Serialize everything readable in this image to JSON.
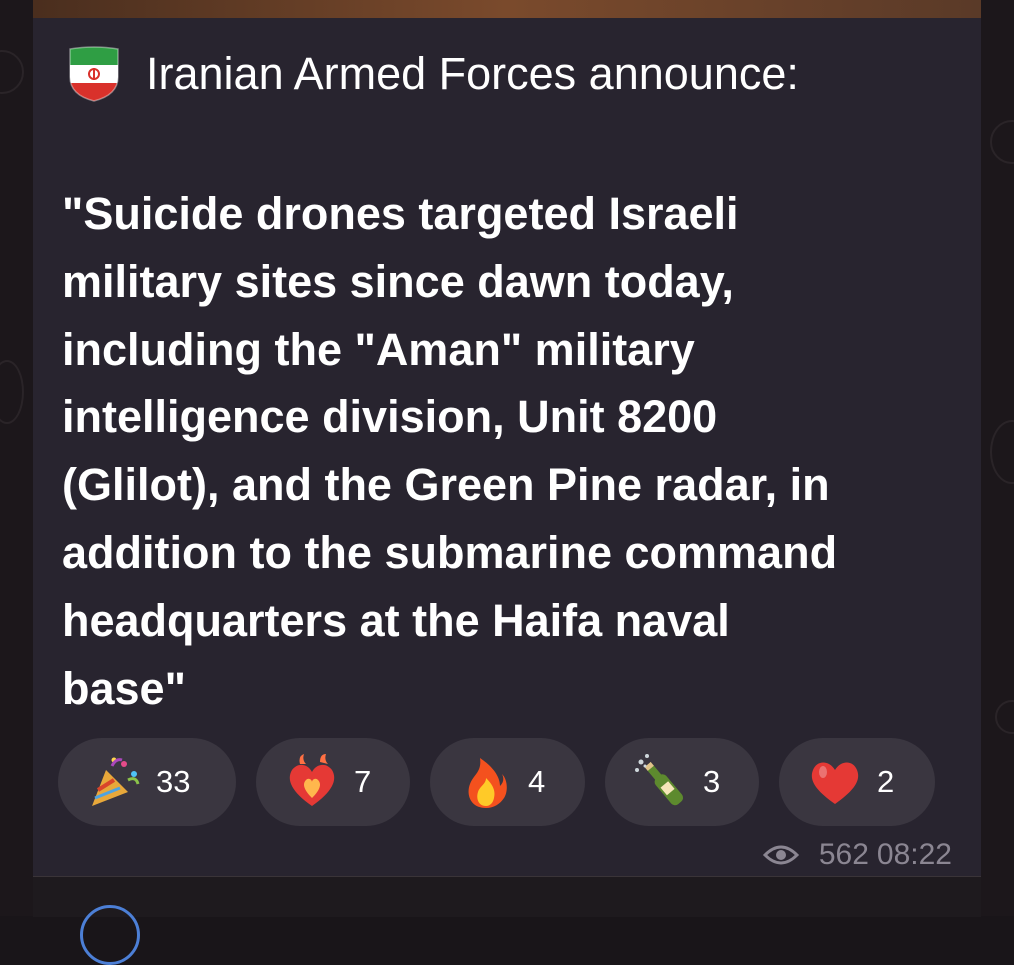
{
  "post": {
    "header": "Iranian Armed Forces announce:",
    "body_lines": [
      "\"Suicide drones targeted Israeli",
      "military sites since dawn today,",
      "including the \"Aman\" military",
      "intelligence division, Unit 8200",
      "(Glilot), and the Green Pine radar, in",
      "addition to the submarine command",
      "headquarters at the Haifa naval",
      "base\""
    ],
    "flag_icon": "iran-flag-emoji"
  },
  "reactions": [
    {
      "icon": "party-popper-icon",
      "count": "33"
    },
    {
      "icon": "heart-on-fire-icon",
      "count": "7"
    },
    {
      "icon": "fire-icon",
      "count": "4"
    },
    {
      "icon": "champagne-bottle-icon",
      "count": "3"
    },
    {
      "icon": "red-heart-icon",
      "count": "2"
    }
  ],
  "meta": {
    "views": "562",
    "time": "08:22"
  },
  "colors": {
    "bubble": "#28242f",
    "reaction_pill": "#3a3640",
    "meta_text": "#8b8692"
  }
}
